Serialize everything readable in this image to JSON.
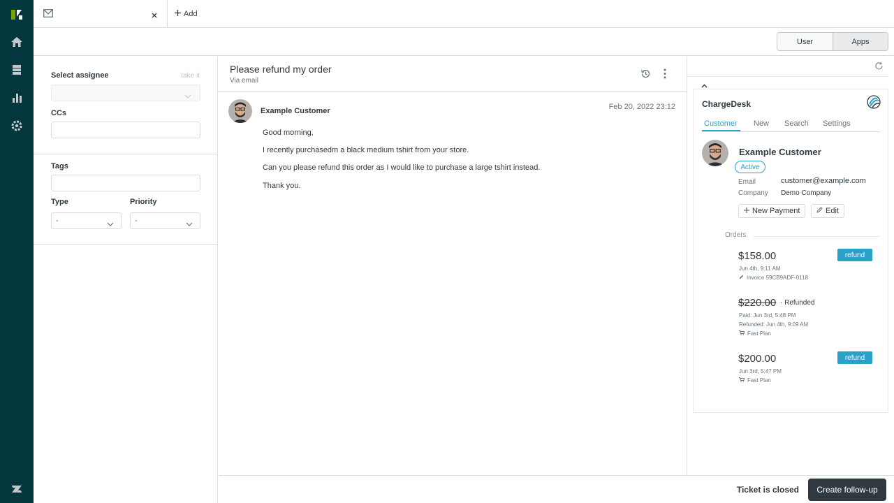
{
  "topbar": {
    "add_label": "Add"
  },
  "subheader": {
    "user_label": "User",
    "apps_label": "Apps"
  },
  "properties": {
    "assignee_label": "Select assignee",
    "take_it_label": "take it",
    "ccs_label": "CCs",
    "tags_label": "Tags",
    "type_label": "Type",
    "type_value": "-",
    "priority_label": "Priority",
    "priority_value": "-"
  },
  "ticket": {
    "title": "Please refund my order",
    "via": "Via email",
    "message": {
      "author": "Example Customer",
      "date": "Feb 20, 2022 23:12",
      "lines": [
        "Good morning,",
        "I recently purchasedm a black medium tshirt from your store.",
        "Can you please refund this order as I would like to purchase a large tshirt instead.",
        "Thank you."
      ]
    }
  },
  "footer": {
    "status_text": "Ticket is closed",
    "followup_label": "Create follow-up"
  },
  "app": {
    "title": "ChargeDesk",
    "tabs": [
      "Customer",
      "New",
      "Search",
      "Settings"
    ],
    "customer": {
      "name": "Example Customer",
      "status": "Active",
      "email_key": "Email",
      "email_value": "customer@example.com",
      "company_key": "Company",
      "company_value": "Demo Company",
      "new_payment_label": "New Payment",
      "edit_label": "Edit"
    },
    "orders_label": "Orders",
    "orders": [
      {
        "amount": "$158.00",
        "date": "Jun 4th, 9:11 AM",
        "detail": "Invoice 59CB9ADF-0118",
        "action": "refund"
      },
      {
        "amount": "$220.00",
        "status": "· Refunded",
        "paid": "Paid: Jun 3rd, 5:48 PM",
        "refunded": "Refunded: Jun 4th, 9:09 AM",
        "detail": "Fast Plan"
      },
      {
        "amount": "$200.00",
        "date": "Jun 3rd, 5:47 PM",
        "detail": "Fast Plan",
        "action": "refund"
      }
    ]
  },
  "colors": {
    "nav_bg": "#03363d",
    "accent": "#2aa1c9",
    "logo_green": "#78a300",
    "dark_button": "#2f3941"
  },
  "icons": [
    "zendesk-logo-icon",
    "home-icon",
    "views-icon",
    "reporting-icon",
    "settings-icon",
    "mail-icon",
    "close-icon",
    "plus-icon",
    "history-icon",
    "more-icon",
    "chevron-up-icon",
    "refresh-icon",
    "chargedesk-logo-icon",
    "pencil-icon",
    "cart-icon"
  ]
}
